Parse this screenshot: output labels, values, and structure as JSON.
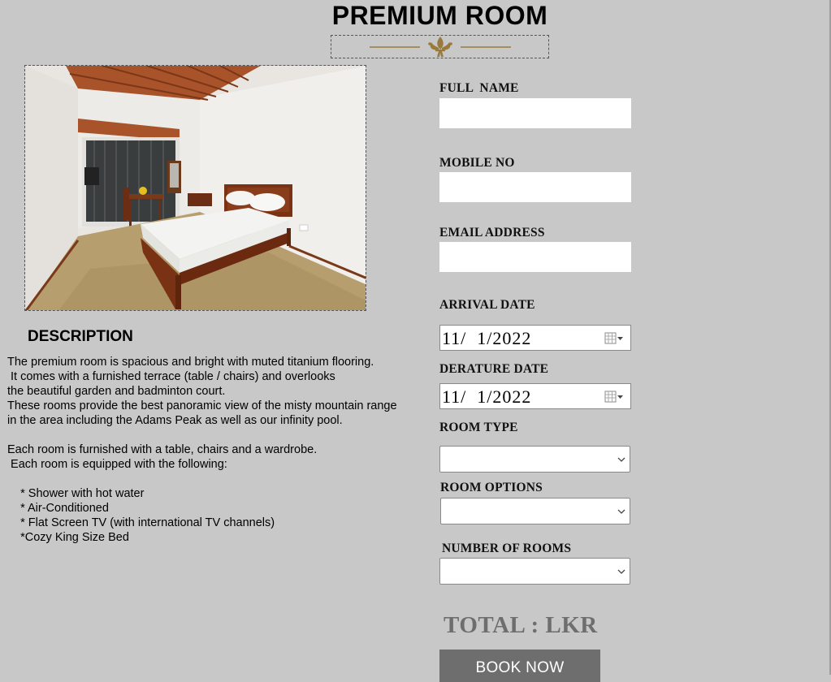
{
  "page": {
    "title": "PREMIUM ROOM"
  },
  "description": {
    "heading": "DESCRIPTION",
    "lines": [
      "The premium room is spacious and bright with muted titanium flooring.",
      " It comes with a furnished terrace (table / chairs) and overlooks",
      "the beautiful garden and badminton court.",
      "These rooms provide the best panoramic view of the misty mountain range",
      "in the area including the Adams Peak as well as our infinity pool.",
      "",
      "Each room is furnished with a table, chairs and a wardrobe.",
      " Each room is equipped with the following:",
      "",
      "    * Shower with hot water",
      "    * Air-Conditioned",
      "    * Flat Screen TV (with international TV channels)",
      "    *Cozy King Size Bed"
    ]
  },
  "form": {
    "full_name_label": "FULL  NAME",
    "mobile_label": "MOBILE NO",
    "email_label": "EMAIL ADDRESS",
    "arrival_label": "ARRIVAL DATE",
    "arrival_value": "11/  1/2022",
    "departure_label": "DERATURE DATE",
    "departure_value": "11/  1/2022",
    "room_type_label": "ROOM TYPE",
    "room_options_label": "ROOM OPTIONS",
    "num_rooms_label": "NUMBER OF ROOMS",
    "room_type_value": "",
    "room_options_value": "",
    "num_rooms_value": ""
  },
  "total_label": "TOTAL : LKR",
  "book_button": "BOOK NOW",
  "colors": {
    "background": "#c8c8c8",
    "ornament_gold": "#9a7a3c",
    "button": "#6e6e6e",
    "total_text": "#6e6e6e"
  },
  "icons": {
    "ornament": "fleur-de-lis-ornament",
    "calendar": "calendar-icon",
    "dropdown": "chevron-down-icon"
  }
}
